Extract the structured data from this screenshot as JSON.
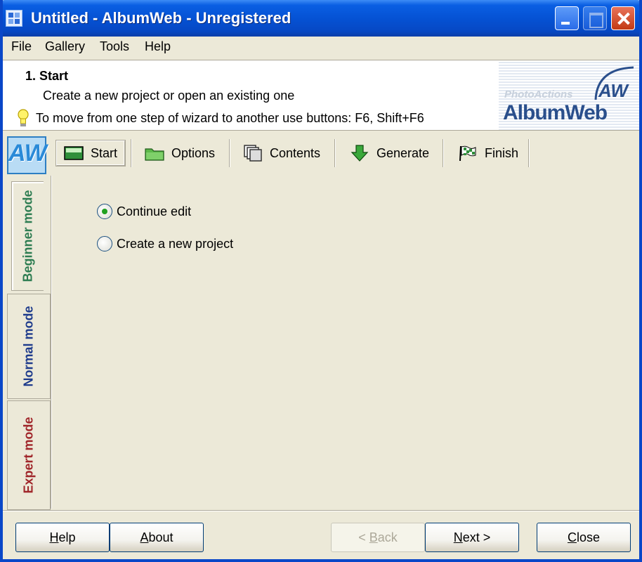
{
  "window": {
    "title": "Untitled - AlbumWeb - Unregistered"
  },
  "menu": [
    "File",
    "Gallery",
    "Tools",
    "Help"
  ],
  "header": {
    "step_title": "1.  Start",
    "step_description": "Create a new project or open an existing one",
    "hint": "To move from one step of wizard to another use buttons: F6, Shift+F6",
    "logo_sub": "PhotoActions",
    "logo_main": "AlbumWeb",
    "logo_badge": "AW"
  },
  "modes": {
    "logo": "AW",
    "beginner": "Beginner mode",
    "normal": "Normal mode",
    "expert": "Expert mode"
  },
  "tabs": [
    {
      "label": "Start",
      "icon": "start-icon",
      "active": true
    },
    {
      "label": "Options",
      "icon": "folder-icon",
      "active": false
    },
    {
      "label": "Contents",
      "icon": "pages-icon",
      "active": false
    },
    {
      "label": "Generate",
      "icon": "down-arrow-icon",
      "active": false
    },
    {
      "label": "Finish",
      "icon": "finish-flag-icon",
      "active": false
    }
  ],
  "options": {
    "continue_edit": "Continue edit",
    "create_new": "Create a new project",
    "selected": "continue_edit"
  },
  "buttons": {
    "help": {
      "pre": "",
      "key": "H",
      "post": "elp"
    },
    "about": {
      "pre": "",
      "key": "A",
      "post": "bout"
    },
    "back": {
      "pre": "< ",
      "key": "B",
      "post": "ack"
    },
    "next": {
      "pre": "",
      "key": "N",
      "post": "ext >"
    },
    "close": {
      "pre": "",
      "key": "C",
      "post": "lose"
    }
  },
  "colors": {
    "titlebar": "#0552d4",
    "window_bg": "#ece9d8",
    "beginner": "#2e7d52",
    "normal": "#1f3c8c",
    "expert": "#a0262a"
  }
}
